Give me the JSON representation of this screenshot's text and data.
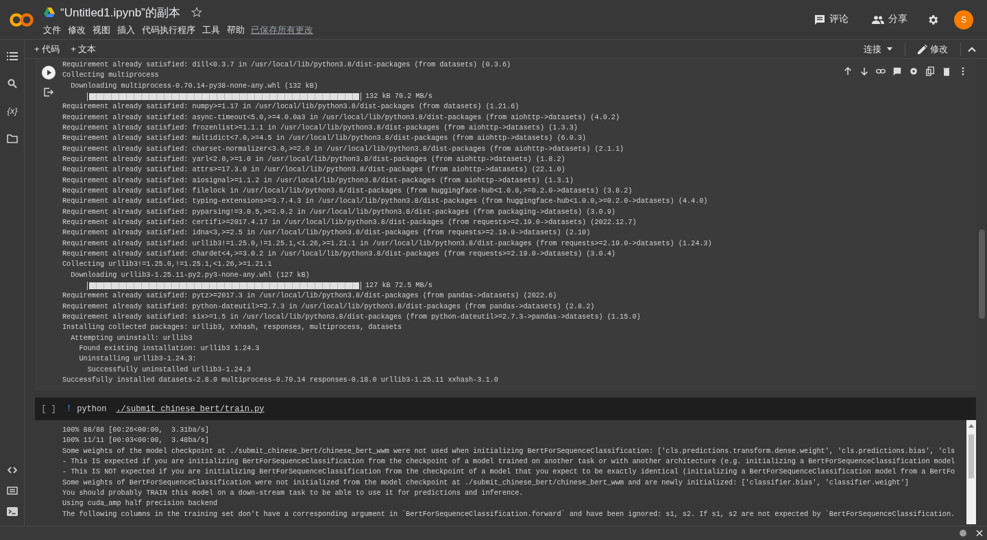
{
  "app": {
    "title": "“Untitled1.ipynb”的副本",
    "starred": false,
    "menu": [
      "文件",
      "修改",
      "视图",
      "插入",
      "代码执行程序",
      "工具",
      "帮助"
    ],
    "save_status": "已保存所有更改",
    "comment": "评论",
    "share": "分享",
    "avatar": "S"
  },
  "toolbar": {
    "add": [
      "+ 代码",
      "+ 文本"
    ],
    "connect": "连接",
    "edit": "修改"
  },
  "sidebar": {
    "variables": "{x}"
  },
  "cells": [
    {
      "selected": true,
      "output": [
        {
          "kind": "text",
          "text": "Requirement already satisfied: dill<0.3.7 in /usr/local/lib/python3.8/dist-packages (from datasets) (0.3.6)"
        },
        {
          "kind": "text",
          "text": "Collecting multiprocess"
        },
        {
          "kind": "text",
          "text": "  Downloading multiprocess-0.70.14-py38-none-any.whl (132 kB)"
        },
        {
          "kind": "progress",
          "level": 1,
          "reading": "132 kB 70.2 MB/s"
        },
        {
          "kind": "text",
          "text": "Requirement already satisfied: numpy>=1.17 in /usr/local/lib/python3.8/dist-packages (from datasets) (1.21.6)"
        },
        {
          "kind": "text",
          "text": "Requirement already satisfied: async-timeout<5.0,>=4.0.0a3 in /usr/local/lib/python3.8/dist-packages (from aiohttp->datasets) (4.0.2)"
        },
        {
          "kind": "text",
          "text": "Requirement already satisfied: frozenlist>=1.1.1 in /usr/local/lib/python3.8/dist-packages (from aiohttp->datasets) (1.3.3)"
        },
        {
          "kind": "text",
          "text": "Requirement already satisfied: multidict<7.0,>=4.5 in /usr/local/lib/python3.8/dist-packages (from aiohttp->datasets) (6.0.3)"
        },
        {
          "kind": "text",
          "text": "Requirement already satisfied: charset-normalizer<3.0,>=2.0 in /usr/local/lib/python3.8/dist-packages (from aiohttp->datasets) (2.1.1)"
        },
        {
          "kind": "text",
          "text": "Requirement already satisfied: yarl<2.0,>=1.0 in /usr/local/lib/python3.8/dist-packages (from aiohttp->datasets) (1.8.2)"
        },
        {
          "kind": "text",
          "text": "Requirement already satisfied: attrs>=17.3.0 in /usr/local/lib/python3.8/dist-packages (from aiohttp->datasets) (22.1.0)"
        },
        {
          "kind": "text",
          "text": "Requirement already satisfied: aiosignal>=1.1.2 in /usr/local/lib/python3.8/dist-packages (from aiohttp->datasets) (1.3.1)"
        },
        {
          "kind": "text",
          "text": "Requirement already satisfied: filelock in /usr/local/lib/python3.8/dist-packages (from huggingface-hub<1.0.0,>=0.2.0->datasets) (3.8.2)"
        },
        {
          "kind": "text",
          "text": "Requirement already satisfied: typing-extensions>=3.7.4.3 in /usr/local/lib/python3.8/dist-packages (from huggingface-hub<1.0.0,>=0.2.0->datasets) (4.4.0)"
        },
        {
          "kind": "text",
          "text": "Requirement already satisfied: pyparsing!=3.0.5,>=2.0.2 in /usr/local/lib/python3.8/dist-packages (from packaging->datasets) (3.0.9)"
        },
        {
          "kind": "text",
          "text": "Requirement already satisfied: certifi>=2017.4.17 in /usr/local/lib/python3.8/dist-packages (from requests>=2.19.0->datasets) (2022.12.7)"
        },
        {
          "kind": "text",
          "text": "Requirement already satisfied: idna<3,>=2.5 in /usr/local/lib/python3.8/dist-packages (from requests>=2.19.0->datasets) (2.10)"
        },
        {
          "kind": "text",
          "text": "Requirement already satisfied: urllib3!=1.25.0,!=1.25.1,<1.26,>=1.21.1 in /usr/local/lib/python3.8/dist-packages (from requests>=2.19.0->datasets) (1.24.3)"
        },
        {
          "kind": "text",
          "text": "Requirement already satisfied: chardet<4,>=3.0.2 in /usr/local/lib/python3.8/dist-packages (from requests>=2.19.0->datasets) (3.0.4)"
        },
        {
          "kind": "text",
          "text": "Collecting urllib3!=1.25.0,!=1.25.1,<1.26,>=1.21.1"
        },
        {
          "kind": "text",
          "text": "  Downloading urllib3-1.25.11-py2.py3-none-any.whl (127 kB)"
        },
        {
          "kind": "progress",
          "level": 1,
          "reading": "127 kB 72.5 MB/s"
        },
        {
          "kind": "text",
          "text": "Requirement already satisfied: pytz>=2017.3 in /usr/local/lib/python3.8/dist-packages (from pandas->datasets) (2022.6)"
        },
        {
          "kind": "text",
          "text": "Requirement already satisfied: python-dateutil>=2.7.3 in /usr/local/lib/python3.8/dist-packages (from pandas->datasets) (2.8.2)"
        },
        {
          "kind": "text",
          "text": "Requirement already satisfied: six>=1.5 in /usr/local/lib/python3.8/dist-packages (from python-dateutil>=2.7.3->pandas->datasets) (1.15.0)"
        },
        {
          "kind": "text",
          "text": "Installing collected packages: urllib3, xxhash, responses, multiprocess, datasets"
        },
        {
          "kind": "text",
          "text": "  Attempting uninstall: urllib3"
        },
        {
          "kind": "text",
          "text": "    Found existing installation: urllib3 1.24.3"
        },
        {
          "kind": "text",
          "text": "    Uninstalling urllib3-1.24.3:"
        },
        {
          "kind": "text",
          "text": "      Successfully uninstalled urllib3-1.24.3"
        },
        {
          "kind": "text",
          "text": "Successfully installed datasets-2.8.0 multiprocess-0.70.14 responses-0.18.0 urllib3-1.25.11 xxhash-3.1.0"
        }
      ]
    },
    {
      "selected": false,
      "exec_count": "[ ]",
      "code": {
        "bang": "!",
        "command": "python",
        "path": "./submit_chinese_bert/train.py"
      },
      "output": [
        {
          "kind": "text",
          "text": "100% 88/88 [00:26<00:00,  3.31ba/s]"
        },
        {
          "kind": "text",
          "text": "100% 11/11 [00:03<00:00,  3.48ba/s]"
        },
        {
          "kind": "text",
          "text": "Some weights of the model checkpoint at ./submit_chinese_bert/chinese_bert_wwm were not used when initializing BertForSequenceClassification: ['cls.predictions.transform.dense.weight', 'cls.predictions.bias', 'cls"
        },
        {
          "kind": "text",
          "text": "- This IS expected if you are initializing BertForSequenceClassification from the checkpoint of a model trained on another task or with another architecture (e.g. initializing a BertForSequenceClassification model"
        },
        {
          "kind": "text",
          "text": "- This IS NOT expected if you are initializing BertForSequenceClassification from the checkpoint of a model that you expect to be exactly identical (initializing a BertForSequenceClassification model from a BertFo"
        },
        {
          "kind": "text",
          "text": "Some weights of BertForSequenceClassification were not initialized from the model checkpoint at ./submit_chinese_bert/chinese_bert_wwm and are newly initialized: ['classifier.bias', 'classifier.weight']"
        },
        {
          "kind": "text",
          "text": "You should probably TRAIN this model on a down-stream task to be able to use it for predictions and inference."
        },
        {
          "kind": "text",
          "text": "Using cuda_amp half precision backend"
        },
        {
          "kind": "text",
          "text": "The following columns in the training set don't have a corresponding argument in `BertForSequenceClassification.forward` and have been ignored: s1, s2. If s1, s2 are not expected by `BertForSequenceClassification."
        }
      ]
    }
  ]
}
